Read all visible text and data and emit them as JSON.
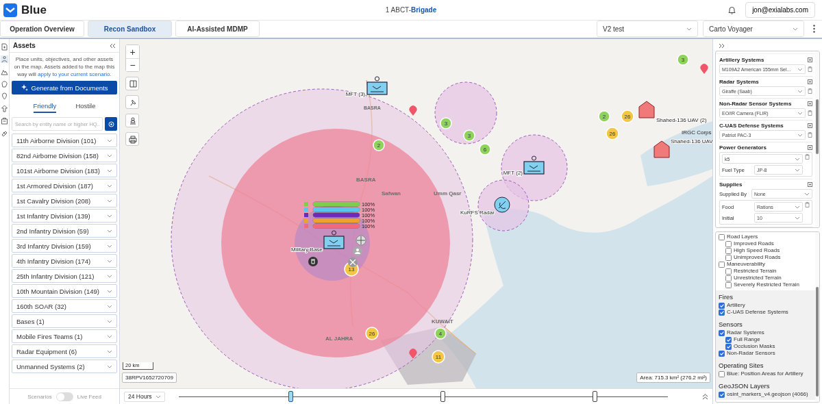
{
  "app": {
    "name": "Blue",
    "context": "1 ABCT-**Brigade**",
    "user": "jon@exialabs.com"
  },
  "tabs": [
    {
      "label": "Operation Overview",
      "selected": false
    },
    {
      "label": "Recon Sandbox",
      "selected": true
    },
    {
      "label": "AI-Assisted MDMP",
      "selected": false
    }
  ],
  "selectors": [
    "V2 test",
    "Carto Voyager"
  ],
  "assets": {
    "title": "Assets",
    "description": "Place units, objectives, and other assets on the map. Assets added to the map this way will",
    "link": "apply to your current scenario.",
    "generate_button": "Generate from Documents",
    "filter_tabs": [
      {
        "label": "Friendly",
        "selected": true
      },
      {
        "label": "Hostile",
        "selected": false
      }
    ],
    "search": {
      "placeholder": "Search by entity name or higher HQ.."
    },
    "groups": [
      "11th Airborne Division (101)",
      "82nd Airborne Division (158)",
      "101st Airborne Division (183)",
      "1st Armored Division (187)",
      "1st Cavalry Division (208)",
      "1st Infantry Division (139)",
      "2nd Infantry Division (59)",
      "3rd Infantry Division (159)",
      "4th Infantry Division (174)",
      "25th Infantry Division (121)",
      "10th Mountain Division (149)",
      "160th SOAR (32)",
      "Bases (1)",
      "Mobile Fires Teams (1)",
      "Radar Equipment (6)",
      "Unmanned Systems (2)"
    ],
    "footer": {
      "left": "Scenarios",
      "right": "Live Feed",
      "on": false
    }
  },
  "map": {
    "places": [
      "BASRA",
      "BASRA",
      "Safwan",
      "Umm Qasr",
      "KUWAIT",
      "AL JAHRA",
      "IRGC Corps"
    ],
    "clusters": [
      {
        "count": "3",
        "color": "#8fd35c"
      },
      {
        "count": "2",
        "color": "#8fd35c"
      },
      {
        "count": "3",
        "color": "#8fd35c"
      },
      {
        "count": "3",
        "color": "#8fd35c"
      },
      {
        "count": "6",
        "color": "#8fd35c"
      },
      {
        "count": "2",
        "color": "#8fd35c"
      },
      {
        "count": "26",
        "color": "#f3c745"
      },
      {
        "count": "26",
        "color": "#f3c745"
      },
      {
        "count": "13",
        "color": "#f3c745"
      },
      {
        "count": "26",
        "color": "#f3c745"
      },
      {
        "count": "4",
        "color": "#8fd35c"
      },
      {
        "count": "11",
        "color": "#f3c745"
      }
    ],
    "units": [
      {
        "label": "MFT (3)",
        "kind": "friendly"
      },
      {
        "label": "MFT (2)",
        "kind": "friendly"
      },
      {
        "label": "KuRFS Radar",
        "kind": "radar"
      },
      {
        "label": "Military Base",
        "kind": "friendly"
      },
      {
        "label": "Shahed-136 UAV (2)",
        "kind": "hostile"
      },
      {
        "label": "Shahed-136 UAV",
        "kind": "hostile"
      }
    ],
    "status_bars": [
      {
        "level": 1,
        "color": "#7ccf4a",
        "reading": "100%"
      },
      {
        "level": 1,
        "color": "#5bc4f0",
        "reading": "100%"
      },
      {
        "level": 1,
        "color": "#6a2bb8",
        "reading": "100%"
      },
      {
        "level": 1,
        "color": "#f0a030",
        "reading": "100%"
      },
      {
        "level": 1,
        "color": "#f06a7a",
        "reading": "100%"
      }
    ],
    "zoom_buttons": [
      "+",
      "−"
    ],
    "scale": "20 km",
    "coordinates": "38RPV1652720709",
    "area": "Area: 715.3 km² (276.2 mi²)",
    "time_range": "24 Hours",
    "timeline_handles": [
      {
        "selected": true
      },
      {
        "selected": false
      },
      {
        "selected": false
      }
    ]
  },
  "config": {
    "sections": [
      {
        "title": "Artillery Systems",
        "fields": [
          {
            "kind": "select",
            "value": "M109A2 American 155mm Sel..."
          }
        ]
      },
      {
        "title": "Radar Systems",
        "fields": [
          {
            "kind": "select",
            "value": "Giraffe (Saab)"
          }
        ]
      },
      {
        "title": "Non-Radar Sensor Systems",
        "fields": [
          {
            "kind": "select",
            "value": "EO/IR Camera (FLIR)"
          }
        ]
      },
      {
        "title": "C-UAS Defense Systems",
        "fields": [
          {
            "kind": "select",
            "value": "Patriot PAC-3"
          }
        ]
      },
      {
        "title": "Power Generators",
        "fields": [
          {
            "kind": "group",
            "rows": [
              {
                "value": "k5"
              },
              {
                "label": "Fuel Type",
                "value": "JP-8"
              }
            ]
          }
        ]
      },
      {
        "title": "Supplies",
        "fields": [
          {
            "kind": "labeled",
            "label": "Supplied By",
            "value": "None"
          },
          {
            "kind": "group",
            "rows": [
              {
                "label": "Food",
                "value": "Rations"
              },
              {
                "label": "Initial",
                "value": "10"
              }
            ]
          }
        ]
      }
    ]
  },
  "layers": {
    "sections": [
      {
        "items": [
          {
            "label": "Road Layers",
            "checked": false,
            "children": [
              {
                "label": "Improved Roads",
                "checked": false
              },
              {
                "label": "High Speed Roads",
                "checked": false
              },
              {
                "label": "Unimproved Roads",
                "checked": false
              }
            ]
          },
          {
            "label": "Maneuverability",
            "checked": false,
            "children": [
              {
                "label": "Restricted Terrain",
                "checked": false
              },
              {
                "label": "Unrestricted Terrain",
                "checked": false
              },
              {
                "label": "Severely Restricted Terrain",
                "checked": false
              }
            ]
          }
        ]
      },
      {
        "title": "Fires",
        "items": [
          {
            "label": "Artillery",
            "checked": true
          },
          {
            "label": "C-UAS Defense Systems",
            "checked": true
          }
        ]
      },
      {
        "title": "Sensors",
        "items": [
          {
            "label": "Radar Systems",
            "checked": true,
            "children": [
              {
                "label": "Full Range",
                "checked": true
              },
              {
                "label": "Occlusion Masks",
                "checked": true
              }
            ]
          },
          {
            "label": "Non-Radar Sensors",
            "checked": true
          }
        ]
      },
      {
        "title": "Operating Sites",
        "items": [
          {
            "label": "Blue: Position Areas for Artillery",
            "checked": false
          }
        ]
      },
      {
        "title": "GeoJSON Layers",
        "items": [
          {
            "label": "osint_markers_v4.geojson (4066)",
            "checked": true
          }
        ]
      }
    ]
  }
}
